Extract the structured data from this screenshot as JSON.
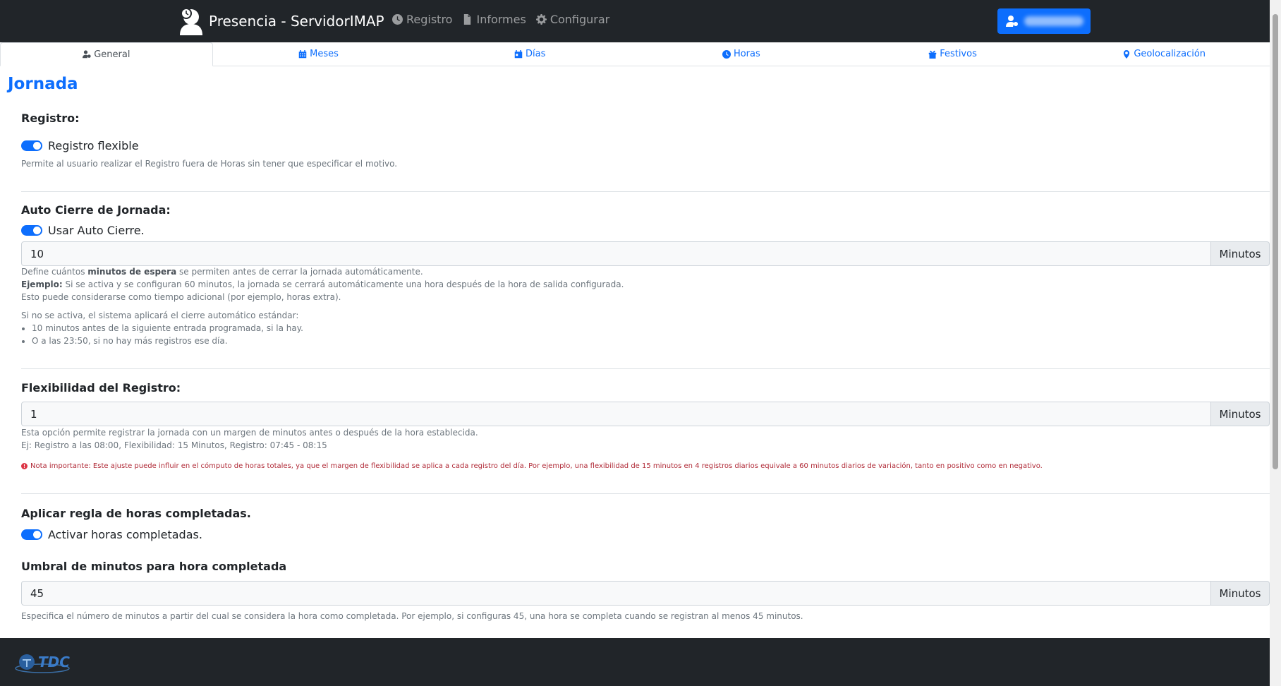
{
  "colors": {
    "navbar": "#212529",
    "accent": "#0d6efd",
    "warning": "#dc3545",
    "muted": "#6c757d"
  },
  "navbar": {
    "brand": "Presencia - ServidorIMAP",
    "links": [
      {
        "label": "Registro",
        "icon": "clock-icon"
      },
      {
        "label": "Informes",
        "icon": "file-icon"
      },
      {
        "label": "Configurar",
        "icon": "gear-icon"
      }
    ]
  },
  "tabs": [
    {
      "label": "General",
      "icon": "user-gear-icon",
      "active": true
    },
    {
      "label": "Meses",
      "icon": "calendar-grid-icon"
    },
    {
      "label": "Días",
      "icon": "calendar-day-icon"
    },
    {
      "label": "Horas",
      "icon": "clock-icon"
    },
    {
      "label": "Festivos",
      "icon": "gift-icon"
    },
    {
      "label": "Geolocalización",
      "icon": "map-pin-icon"
    }
  ],
  "page": {
    "title": "Jornada"
  },
  "registro": {
    "title": "Registro:",
    "switch_label": "Registro flexible",
    "help": "Permite al usuario realizar el Registro fuera de Horas sin tener que especificar el motivo."
  },
  "auto_cierre": {
    "title": "Auto Cierre de Jornada:",
    "switch_label": "Usar Auto Cierre.",
    "value": "10",
    "unit": "Minutos",
    "help1_a": "Define cuántos ",
    "help1_b": "minutos de espera",
    "help1_c": " se permiten antes de cerrar la jornada automáticamente.",
    "help2_a": "Ejemplo:",
    "help2_b": " Si se activa y se configuran 60 minutos, la jornada se cerrará automáticamente una hora después de la hora de salida configurada.",
    "help3": "Esto puede considerarse como tiempo adicional (por ejemplo, horas extra).",
    "help4": "Si no se activa, el sistema aplicará el cierre automático estándar:",
    "bullets": [
      "10 minutos antes de la siguiente entrada programada, si la hay.",
      "O a las 23:50, si no hay más registros ese día."
    ]
  },
  "flexibilidad": {
    "title": "Flexibilidad del Registro:",
    "value": "1",
    "unit": "Minutos",
    "help1": "Esta opción permite registrar la jornada con un margen de minutos antes o después de la hora establecida.",
    "help2": "Ej: Registro a las 08:00, Flexibilidad: 15 Minutos, Registro: 07:45 - 08:15",
    "warning": "Nota importante: Este ajuste puede influir en el cómputo de horas totales, ya que el margen de flexibilidad se aplica a cada registro del día. Por ejemplo, una flexibilidad de 15 minutos en 4 registros diarios equivale a 60 minutos diarios de variación, tanto en positivo como en negativo."
  },
  "horas_completadas": {
    "title": "Aplicar regla de horas completadas.",
    "switch_label": "Activar horas completadas."
  },
  "umbral": {
    "title": "Umbral de minutos para hora completada",
    "value": "45",
    "unit": "Minutos",
    "help": "Especifica el número de minutos a partir del cual se considera la hora como completada. Por ejemplo, si configuras 45, una hora se completa cuando se registran al menos 45 minutos."
  },
  "footer": {
    "logo_text": "TDC"
  }
}
